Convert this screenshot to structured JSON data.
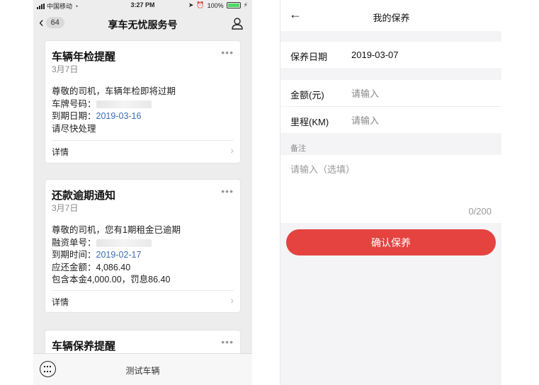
{
  "left_phone": {
    "status_bar": {
      "carrier": "中国移动",
      "time": "3:27 PM",
      "battery_percent": "100%",
      "battery_level": 1.0
    },
    "nav": {
      "back_count": "64",
      "title": "享车无忧服务号"
    },
    "cards": [
      {
        "title": "车辆年检提醒",
        "date": "3月7日",
        "lines": [
          {
            "label": "尊敬的司机，车辆年检即将过期",
            "value": ""
          },
          {
            "label": "车牌号码：",
            "value": ""
          },
          {
            "label": "到期日期：",
            "value": "2019-03-16"
          },
          {
            "label": "请尽快处理",
            "value": ""
          }
        ],
        "footer": "详情"
      },
      {
        "title": "还款逾期通知",
        "date": "3月7日",
        "lines": [
          {
            "label": "尊敬的司机，您有1期租金已逾期",
            "value": ""
          },
          {
            "label": "融资单号：",
            "value": ""
          },
          {
            "label": "到期时间：",
            "value": "2019-02-17"
          },
          {
            "label": "应还金额：",
            "value": "4,086.40"
          },
          {
            "label": "包含本金4,000.00，罚息86.40",
            "value": ""
          }
        ],
        "footer": "详情"
      },
      {
        "title": "车辆保养提醒"
      }
    ],
    "bottom_bar": {
      "label": "测试车辆"
    }
  },
  "right_phone": {
    "header": {
      "title": "我的保养"
    },
    "form": {
      "date_label": "保养日期",
      "date_value": "2019-03-07",
      "amount_label": "金额(元)",
      "amount_placeholder": "请输入",
      "mileage_label": "里程(KM)",
      "mileage_placeholder": "请输入",
      "note_label": "备注",
      "note_placeholder": "请输入（选填）",
      "note_counter": "0/200"
    },
    "confirm_label": "确认保养",
    "colors": {
      "accent": "#e5433f",
      "link_blue": "#3a6db5"
    }
  }
}
